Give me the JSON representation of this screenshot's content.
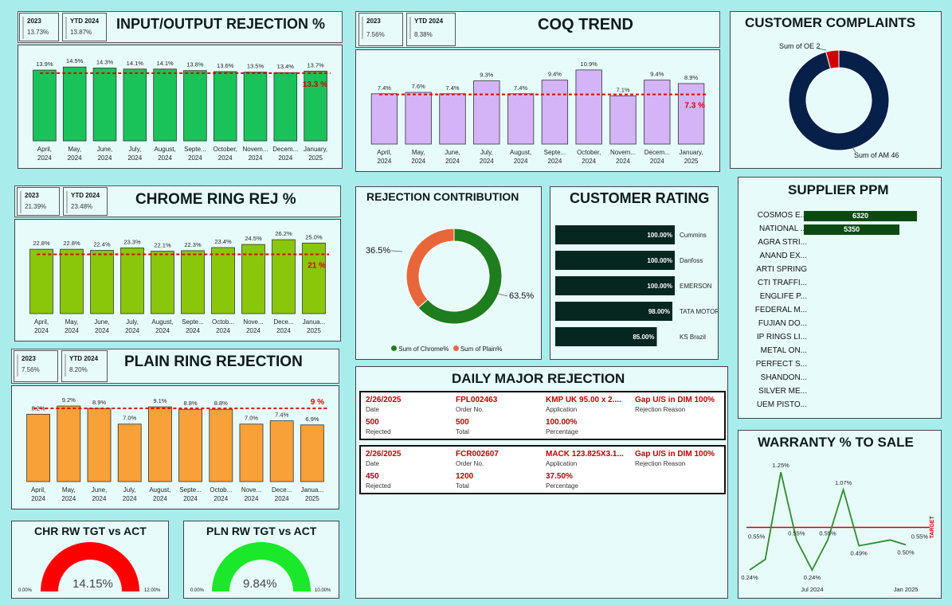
{
  "io_rejection": {
    "title": "INPUT/OUTPUT REJECTION %",
    "kpi_2023_label": "2023",
    "kpi_2023_value": "13.73%",
    "kpi_ytd_label": "YTD 2024",
    "kpi_ytd_value": "13.87%",
    "target_label": "13.3 %"
  },
  "coq": {
    "title": "COQ TREND",
    "kpi_2023_label": "2023",
    "kpi_2023_value": "7.56%",
    "kpi_ytd_label": "YTD 2024",
    "kpi_ytd_value": "8.38%",
    "target_label": "7.3 %"
  },
  "chrome": {
    "title": "CHROME RING REJ %",
    "kpi_2023_label": "2023",
    "kpi_2023_value": "21.39%",
    "kpi_ytd_label": "YTD 2024",
    "kpi_ytd_value": "23.48%",
    "target_label": "21 %"
  },
  "plain": {
    "title": "PLAIN RING REJECTION",
    "kpi_2023_label": "2023",
    "kpi_2023_value": "7.56%",
    "kpi_ytd_label": "YTD 2024",
    "kpi_ytd_value": "8.20%",
    "target_label": "9 %"
  },
  "complaints": {
    "title": "CUSTOMER COMPLAINTS",
    "label_oe": "Sum of OE 2",
    "label_am": "Sum of AM 46"
  },
  "contribution": {
    "title": "REJECTION CONTRIBUTION",
    "label_plain": "36.5%",
    "label_chrome": "63.5%",
    "legend_chrome": "Sum of Chrome%",
    "legend_plain": "Sum of Plain%"
  },
  "rating": {
    "title": "CUSTOMER RATING"
  },
  "ppm": {
    "title": "SUPPLIER PPM"
  },
  "daily": {
    "title": "DAILY MAJOR REJECTION",
    "cap_date": "Date",
    "cap_order": "Order No.",
    "cap_app": "Application",
    "cap_reason": "Rejection Reason",
    "cap_rej": "Rejected",
    "cap_total": "Total",
    "cap_pct": "Percentage",
    "rows": [
      {
        "date": "2/26/2025",
        "order": "FPL002463",
        "app": "KMP UK 95.00 x 2....",
        "reason": "Gap U/S in DIM 100%",
        "rejected": "500",
        "total": "500",
        "pct": "100.00%"
      },
      {
        "date": "2/26/2025",
        "order": "FCR002607",
        "app": "MACK 123.825X3.1...",
        "reason": "Gap U/S in DIM 100%",
        "rejected": "450",
        "total": "1200",
        "pct": "37.50%"
      }
    ]
  },
  "gauge_chr": {
    "title": "CHR RW TGT vs ACT",
    "min": "0.00%",
    "max": "12.00%",
    "value_text": "14.15%"
  },
  "gauge_pln": {
    "title": "PLN RW TGT vs ACT",
    "min": "0.00%",
    "max": "10.00%",
    "value_text": "9.84%"
  },
  "warranty": {
    "title": "WARRANTY % TO SALE",
    "target_label": "TARGET"
  },
  "colors": {
    "bg": "#a9ecec",
    "panel": "#e8fbfb",
    "io_bar": "#19c35a",
    "coq_bar": "#d5b3f7",
    "chrome_bar": "#8ac60a",
    "plain_bar": "#f7a137",
    "navy": "#06204a",
    "red": "#d10000",
    "donut_green": "#1e7d1e",
    "donut_orange": "#e8673a",
    "rating_dark": "#062620",
    "ppm_bar": "#0c4a12",
    "warranty_line": "#2e8b2e"
  },
  "chart_data": [
    {
      "id": "io",
      "type": "bar",
      "categories": [
        [
          "April,",
          "2024"
        ],
        [
          "May,",
          "2024"
        ],
        [
          "June,",
          "2024"
        ],
        [
          "July,",
          "2024"
        ],
        [
          "August,",
          "2024"
        ],
        [
          "Septe...",
          "2024"
        ],
        [
          "October,",
          "2024"
        ],
        [
          "Novem...",
          "2024"
        ],
        [
          "Decem...",
          "2024"
        ],
        [
          "January,",
          "2025"
        ]
      ],
      "values": [
        13.9,
        14.5,
        14.3,
        14.1,
        14.1,
        13.8,
        13.6,
        13.5,
        13.4,
        13.7
      ],
      "data_labels": [
        "13.9%",
        "14.5%",
        "14.3%",
        "14.1%",
        "14.1%",
        "13.8%",
        "13.6%",
        "13.5%",
        "13.4%",
        "13.7%"
      ],
      "target": 13.3,
      "ylim": [
        0,
        15
      ]
    },
    {
      "id": "coq",
      "type": "bar",
      "categories": [
        [
          "April,",
          "2024"
        ],
        [
          "May,",
          "2024"
        ],
        [
          "June,",
          "2024"
        ],
        [
          "July,",
          "2024"
        ],
        [
          "August,",
          "2024"
        ],
        [
          "Septe...",
          "2024"
        ],
        [
          "October,",
          "2024"
        ],
        [
          "Novem...",
          "2024"
        ],
        [
          "Decem...",
          "2024"
        ],
        [
          "January,",
          "2025"
        ]
      ],
      "values": [
        7.4,
        7.6,
        7.4,
        9.3,
        7.4,
        9.4,
        10.9,
        7.1,
        9.4,
        8.9
      ],
      "data_labels": [
        "7.4%",
        "7.6%",
        "7.4%",
        "9.3%",
        "7.4%",
        "9.4%",
        "10.9%",
        "7.1%",
        "9.4%",
        "8.9%"
      ],
      "target": 7.3,
      "ylim": [
        0,
        11
      ]
    },
    {
      "id": "chrome",
      "type": "bar",
      "categories": [
        [
          "April,",
          "2024"
        ],
        [
          "May,",
          "2024"
        ],
        [
          "June,",
          "2024"
        ],
        [
          "July,",
          "2024"
        ],
        [
          "August,",
          "2024"
        ],
        [
          "Septe...",
          "2024"
        ],
        [
          "Octob...",
          "2024"
        ],
        [
          "Nove...",
          "2024"
        ],
        [
          "Dece...",
          "2024"
        ],
        [
          "Janua...",
          "2025"
        ]
      ],
      "values": [
        22.8,
        22.8,
        22.4,
        23.3,
        22.1,
        22.3,
        23.4,
        24.5,
        26.2,
        25.0
      ],
      "data_labels": [
        "22.8%",
        "22.8%",
        "22.4%",
        "23.3%",
        "22.1%",
        "22.3%",
        "23.4%",
        "24.5%",
        "26.2%",
        "25.0%"
      ],
      "target": 21,
      "ylim": [
        0,
        26.5
      ]
    },
    {
      "id": "plain",
      "type": "bar",
      "categories": [
        [
          "April,",
          "2024"
        ],
        [
          "May,",
          "2024"
        ],
        [
          "June,",
          "2024"
        ],
        [
          "July,",
          "2024"
        ],
        [
          "August,",
          "2024"
        ],
        [
          "Septe...",
          "2024"
        ],
        [
          "Octob...",
          "2024"
        ],
        [
          "Nove...",
          "2024"
        ],
        [
          "Dece...",
          "2024"
        ],
        [
          "Janua...",
          "2025"
        ]
      ],
      "values": [
        8.2,
        9.2,
        8.9,
        7.0,
        9.1,
        8.8,
        8.8,
        7.0,
        7.4,
        6.9
      ],
      "data_labels": [
        "8.2%",
        "9.2%",
        "8.9%",
        "7.0%",
        "9.1%",
        "8.8%",
        "8.8%",
        "7.0%",
        "7.4%",
        "6.9%"
      ],
      "target": 9,
      "ylim": [
        0,
        9.3
      ]
    },
    {
      "id": "complaints",
      "type": "pie",
      "categories": [
        "Sum of OE",
        "Sum of AM"
      ],
      "values": [
        2,
        46
      ]
    },
    {
      "id": "contribution",
      "type": "pie",
      "categories": [
        "Sum of Chrome%",
        "Sum of Plain%"
      ],
      "values": [
        63.5,
        36.5
      ]
    },
    {
      "id": "rating",
      "type": "bar",
      "categories": [
        "Cummins",
        "Danfoss",
        "EMERSON",
        "TATA MOTORS",
        "KS Brazil"
      ],
      "values": [
        100,
        100,
        100,
        98,
        85
      ],
      "data_labels": [
        "100.00%",
        "100.00%",
        "100.00%",
        "98.00%",
        "85.00%"
      ],
      "xlim": [
        0,
        100
      ]
    },
    {
      "id": "ppm",
      "type": "bar",
      "categories": [
        "COSMOS E...",
        "NATIONAL ...",
        "AGRA STRI...",
        "ANAND EX...",
        "ARTI SPRING",
        "CTI TRAFFI...",
        "ENGLIFE P...",
        "FEDERAL M...",
        "FUJIAN DO...",
        "IP RINGS LI...",
        "METAL ON...",
        "PERFECT S...",
        "SHANDON...",
        "SILVER ME...",
        "UEM PISTO..."
      ],
      "values": [
        6320,
        5350,
        0,
        0,
        0,
        0,
        0,
        0,
        0,
        0,
        0,
        0,
        0,
        0,
        0
      ],
      "data_labels": [
        "6320",
        "5350"
      ],
      "xlim": [
        0,
        6500
      ]
    },
    {
      "id": "warranty",
      "type": "line",
      "x": [
        "",
        "",
        "",
        "",
        "Jul 2024",
        "",
        "",
        "",
        "",
        "",
        "Jan 2025"
      ],
      "values": [
        0.24,
        0.35,
        1.25,
        0.55,
        0.24,
        0.55,
        1.07,
        0.49,
        0.52,
        0.55,
        0.5
      ],
      "data_labels": [
        "0.24%",
        "",
        "1.25%",
        "0.55%",
        "0.24%",
        "0.55%",
        "1.07%",
        "0.49%",
        "",
        "",
        "0.50%"
      ],
      "left_label": "0.55%",
      "right_label": "0.55%",
      "target": 0.68,
      "ylim": [
        0.15,
        1.35
      ]
    }
  ]
}
